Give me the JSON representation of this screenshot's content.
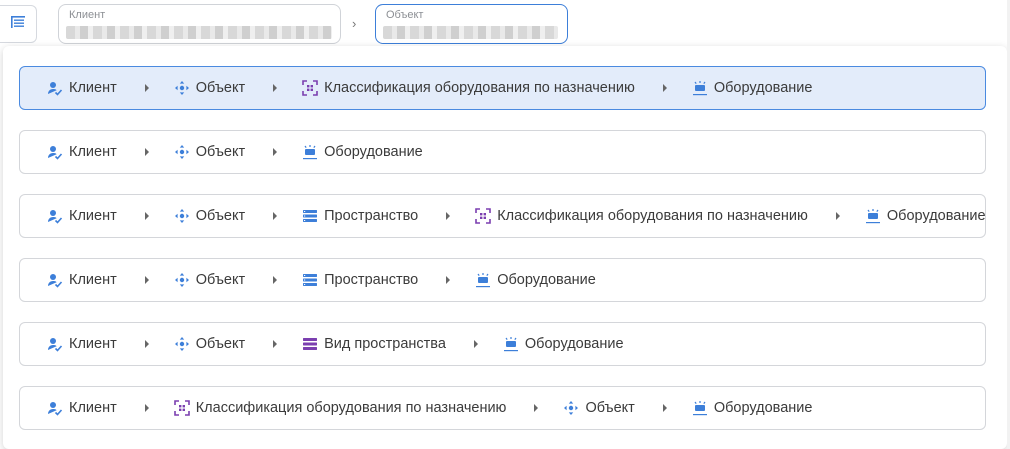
{
  "header": {
    "client_label": "Клиент",
    "object_label": "Объект",
    "chevron": "›"
  },
  "icons": {
    "client": "person-check-icon",
    "object": "move-arrows-icon",
    "classification": "grid-frame-icon",
    "equipment": "equipment-icon",
    "space": "list-icon",
    "space_type": "stacked-bars-icon"
  },
  "colors": {
    "accent": "#3d7fd9",
    "selected_bg": "#e3ecfa",
    "purple": "#7b3fb0"
  },
  "rows": [
    {
      "selected": true,
      "items": [
        {
          "type": "client",
          "label": "Клиент"
        },
        {
          "type": "object",
          "label": "Объект"
        },
        {
          "type": "classification",
          "label": "Классификация оборудования по назначению"
        },
        {
          "type": "equipment",
          "label": "Оборудование"
        }
      ]
    },
    {
      "selected": false,
      "items": [
        {
          "type": "client",
          "label": "Клиент"
        },
        {
          "type": "object",
          "label": "Объект"
        },
        {
          "type": "equipment",
          "label": "Оборудование"
        }
      ]
    },
    {
      "selected": false,
      "items": [
        {
          "type": "client",
          "label": "Клиент"
        },
        {
          "type": "object",
          "label": "Объект"
        },
        {
          "type": "space",
          "label": "Пространство"
        },
        {
          "type": "classification",
          "label": "Классификация оборудования по назначению"
        },
        {
          "type": "equipment",
          "label": "Оборудование"
        }
      ]
    },
    {
      "selected": false,
      "items": [
        {
          "type": "client",
          "label": "Клиент"
        },
        {
          "type": "object",
          "label": "Объект"
        },
        {
          "type": "space",
          "label": "Пространство"
        },
        {
          "type": "equipment",
          "label": "Оборудование"
        }
      ]
    },
    {
      "selected": false,
      "items": [
        {
          "type": "client",
          "label": "Клиент"
        },
        {
          "type": "object",
          "label": "Объект"
        },
        {
          "type": "space_type",
          "label": "Вид пространства"
        },
        {
          "type": "equipment",
          "label": "Оборудование"
        }
      ]
    },
    {
      "selected": false,
      "items": [
        {
          "type": "client",
          "label": "Клиент"
        },
        {
          "type": "classification",
          "label": "Классификация оборудования по назначению"
        },
        {
          "type": "object",
          "label": "Объект"
        },
        {
          "type": "equipment",
          "label": "Оборудование"
        }
      ]
    }
  ]
}
